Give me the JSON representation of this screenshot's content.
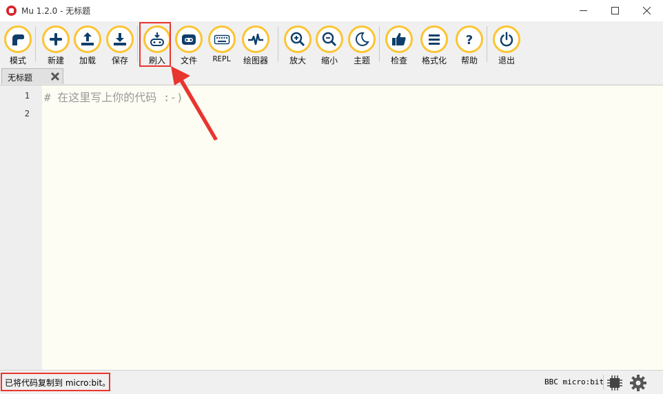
{
  "window": {
    "title": "Mu 1.2.0 - 无标题"
  },
  "toolbar": {
    "buttons": [
      {
        "label": "模式",
        "icon": "mode-icon"
      },
      {
        "label": "新建",
        "icon": "plus-icon"
      },
      {
        "label": "加载",
        "icon": "upload-icon"
      },
      {
        "label": "保存",
        "icon": "download-icon"
      },
      {
        "label": "刷入",
        "icon": "flash-icon"
      },
      {
        "label": "文件",
        "icon": "files-icon"
      },
      {
        "label": "REPL",
        "icon": "keyboard-icon"
      },
      {
        "label": "绘图器",
        "icon": "plotter-icon"
      },
      {
        "label": "放大",
        "icon": "zoom-in-icon"
      },
      {
        "label": "缩小",
        "icon": "zoom-out-icon"
      },
      {
        "label": "主题",
        "icon": "moon-icon"
      },
      {
        "label": "检查",
        "icon": "thumbs-up-icon"
      },
      {
        "label": "格式化",
        "icon": "format-lines-icon"
      },
      {
        "label": "帮助",
        "icon": "question-icon"
      },
      {
        "label": "退出",
        "icon": "power-icon"
      }
    ]
  },
  "tabs": [
    {
      "label": "无标题",
      "close_icon": "close-icon"
    }
  ],
  "editor": {
    "line_numbers": [
      "1",
      "2"
    ],
    "lines": [
      "# 在这里写上你的代码 :-)",
      ""
    ]
  },
  "status": {
    "message": "已将代码复制到 micro:bit。",
    "device": "BBC micro:bit"
  },
  "colors": {
    "accent": "#fbc432",
    "icon": "#0f3e6a",
    "highlight": "#e8352f",
    "editor_bg": "#fefdf4"
  }
}
